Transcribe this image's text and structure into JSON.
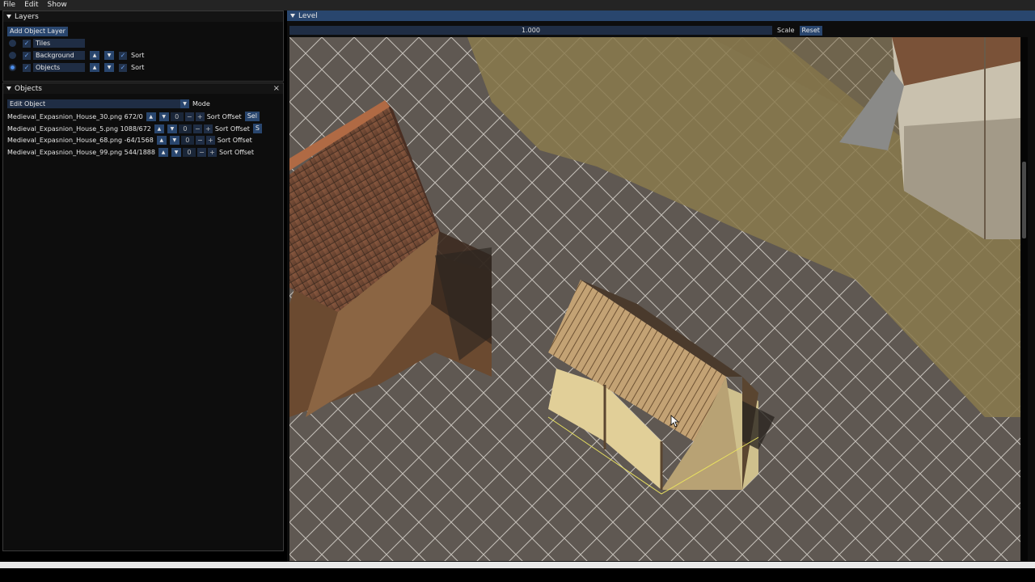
{
  "menubar": {
    "items": [
      "File",
      "Edit",
      "Show"
    ]
  },
  "layers_panel": {
    "title": "Layers",
    "add_button": "Add Object Layer",
    "layers": [
      {
        "name": "Tiles",
        "checked": true,
        "selected": false,
        "has_sort": false
      },
      {
        "name": "Background",
        "checked": true,
        "selected": false,
        "has_sort": true,
        "sort_label": "Sort"
      },
      {
        "name": "Objects",
        "checked": true,
        "selected": true,
        "has_sort": true,
        "sort_label": "Sort"
      }
    ]
  },
  "objects_panel": {
    "title": "Objects",
    "mode_value": "Edit Object",
    "mode_label": "Mode",
    "objects": [
      {
        "name": "Medieval_Expasnion_House_30.png 672/0",
        "offset": "0",
        "sort_label": "Sort Offset",
        "extra": "Sel"
      },
      {
        "name": "Medieval_Expasnion_House_5.png 1088/672",
        "offset": "0",
        "sort_label": "Sort Offset",
        "extra": "S"
      },
      {
        "name": "Medieval_Expasnion_House_68.png -64/1568",
        "offset": "0",
        "sort_label": "Sort Offset",
        "extra": ""
      },
      {
        "name": "Medieval_Expasnion_House_99.png 544/1888",
        "offset": "0",
        "sort_label": "Sort Offset",
        "extra": ""
      }
    ]
  },
  "level_panel": {
    "title": "Level",
    "scale_value": "1.000",
    "scale_label": "Scale",
    "reset_label": "Reset"
  },
  "icons": {
    "up": "▲",
    "down": "▼",
    "check": "✓",
    "minus": "−",
    "plus": "+",
    "close": "×"
  }
}
